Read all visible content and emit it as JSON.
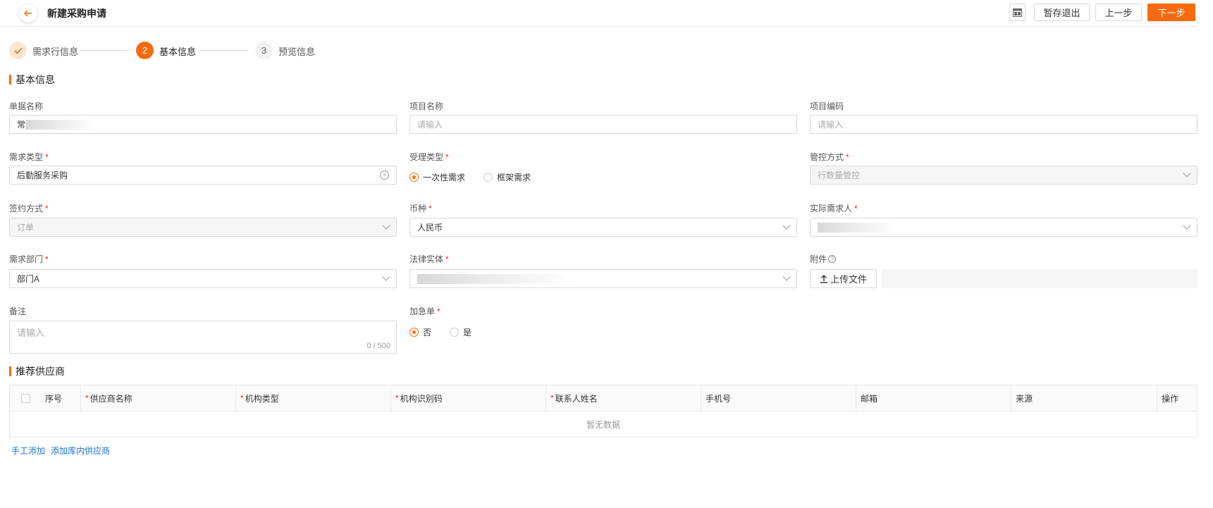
{
  "header": {
    "title": "新建采购申请",
    "buttons": {
      "save_exit": "暂存退出",
      "prev": "上一步",
      "next": "下一步"
    }
  },
  "steps": [
    {
      "number": "",
      "label": "需求行信息",
      "status": "done"
    },
    {
      "number": "2",
      "label": "基本信息",
      "status": "active"
    },
    {
      "number": "3",
      "label": "预览信息",
      "status": "pending"
    }
  ],
  "sections": {
    "basic_info": "基本信息",
    "suppliers": "推荐供应商"
  },
  "form": {
    "doc_name": {
      "label": "单据名称",
      "value": "常"
    },
    "project_name": {
      "label": "项目名称",
      "placeholder": "请输入"
    },
    "project_code": {
      "label": "项目编码",
      "placeholder": "请输入"
    },
    "demand_type": {
      "label": "需求类型",
      "value": "后勤服务采购"
    },
    "accept_type": {
      "label": "受理类型",
      "options": [
        "一次性需求",
        "框架需求"
      ],
      "selected": "一次性需求"
    },
    "control_mode": {
      "label": "管控方式",
      "value": "行数量管控"
    },
    "sign_mode": {
      "label": "签约方式",
      "value": "订单"
    },
    "currency": {
      "label": "币种",
      "value": "人民币"
    },
    "actual_requester": {
      "label": "实际需求人",
      "value": ""
    },
    "demand_dept": {
      "label": "需求部门",
      "value": "部门A"
    },
    "legal_entity": {
      "label": "法律实体",
      "value": ""
    },
    "attachment": {
      "label": "附件",
      "upload_label": "上传文件"
    },
    "remark": {
      "label": "备注",
      "placeholder": "请输入",
      "counter": "0 / 500"
    },
    "urgent": {
      "label": "加急单",
      "options": [
        "否",
        "是"
      ],
      "selected": "否"
    }
  },
  "table": {
    "columns": [
      "序号",
      "供应商名称",
      "机构类型",
      "机构识别码",
      "联系人姓名",
      "手机号",
      "邮箱",
      "来源",
      "操作"
    ],
    "empty_text": "暂无数据"
  },
  "links": {
    "manual_add": "手工添加",
    "add_from_library": "添加库内供应商"
  },
  "colors": {
    "accent": "#f96a0e",
    "link": "#1a73d9",
    "required": "#f5222d"
  }
}
